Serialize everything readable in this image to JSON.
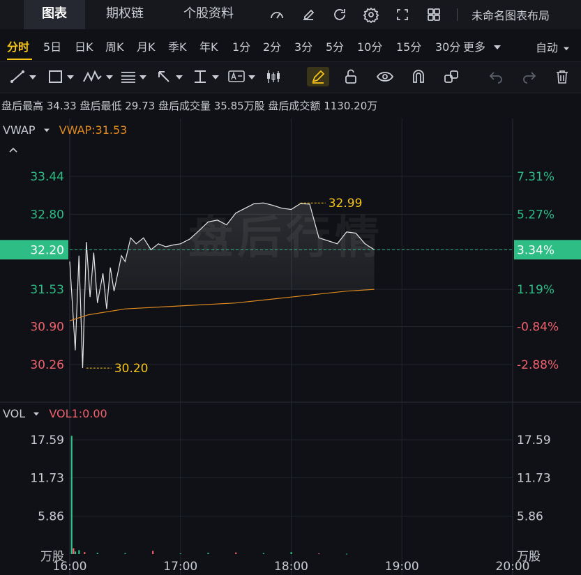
{
  "tabs": [
    {
      "label": "图表",
      "active": true
    },
    {
      "label": "期权链",
      "active": false
    },
    {
      "label": "个股资料",
      "active": false
    }
  ],
  "top_icons": [
    "gauge-icon",
    "edit-icon",
    "refresh-icon",
    "gear-icon",
    "fullscreen-icon",
    "grid-layout-icon"
  ],
  "layout_label": "未命名图表布局",
  "periods": [
    {
      "label": "分时",
      "active": true
    },
    {
      "label": "5日"
    },
    {
      "label": "日K"
    },
    {
      "label": "周K"
    },
    {
      "label": "月K"
    },
    {
      "label": "季K"
    },
    {
      "label": "年K"
    },
    {
      "label": "1分"
    },
    {
      "label": "2分"
    },
    {
      "label": "3分"
    },
    {
      "label": "5分"
    },
    {
      "label": "10分"
    },
    {
      "label": "15分"
    },
    {
      "label": "30分"
    },
    {
      "label": "更多"
    }
  ],
  "auto_label": "自动",
  "stats": "盘后最高 34.33 盘后最低 29.73 盘后成交量 35.85万股 盘后成交额 1130.20万",
  "watermark": "盘后行情",
  "main_legend": {
    "indicator": "VWAP",
    "value_label": "VWAP:31.53"
  },
  "vol_legend": {
    "indicator": "VOL",
    "value_label": "VOL1:0.00"
  },
  "price_ticks": [
    "33.44",
    "32.80",
    "32.20",
    "31.53",
    "30.90",
    "30.26"
  ],
  "pct_ticks": [
    "7.31%",
    "5.27%",
    "3.34%",
    "1.19%",
    "-0.84%",
    "-2.88%"
  ],
  "current_price": "32.20",
  "current_pct": "3.34%",
  "high_label": "32.99",
  "low_label": "30.20",
  "vol_ticks": [
    "17.59",
    "11.73",
    "5.86"
  ],
  "vol_unit": "万股",
  "time_ticks": [
    "16:00",
    "17:00",
    "18:00",
    "19:00",
    "20:00"
  ],
  "colors": {
    "up": "#2ebd85",
    "down": "#f0616d",
    "accent": "#f5c518",
    "vwap": "#e08a1e",
    "price_line": "#e6e6e6",
    "bg": "#0f1116"
  },
  "chart_data": {
    "type": "line",
    "x_unit": "time",
    "price_series": {
      "name": "",
      "x": [
        "16:00",
        "16:03",
        "16:05",
        "16:07",
        "16:09",
        "16:11",
        "16:13",
        "16:15",
        "16:18",
        "16:20",
        "16:22",
        "16:24",
        "16:26",
        "16:28",
        "16:30",
        "16:33",
        "16:36",
        "16:40",
        "16:44",
        "16:48",
        "16:52",
        "16:56",
        "17:00",
        "17:05",
        "17:10",
        "17:15",
        "17:20",
        "17:25",
        "17:30",
        "17:35",
        "17:40",
        "17:45",
        "17:50",
        "17:55",
        "18:00",
        "18:05",
        "18:10",
        "18:15",
        "18:20",
        "18:25",
        "18:30",
        "18:35",
        "18:40",
        "18:45"
      ],
      "values": [
        32.0,
        30.5,
        32.1,
        30.2,
        32.33,
        31.4,
        32.15,
        31.3,
        31.8,
        31.2,
        31.9,
        31.5,
        31.8,
        32.1,
        32.0,
        32.4,
        32.3,
        32.4,
        32.2,
        32.3,
        32.25,
        32.28,
        32.3,
        32.38,
        32.52,
        32.67,
        32.7,
        32.62,
        32.82,
        32.9,
        32.98,
        32.99,
        32.95,
        32.9,
        32.88,
        32.98,
        32.97,
        32.4,
        32.35,
        32.3,
        32.5,
        32.48,
        32.3,
        32.2
      ]
    },
    "vwap_series": {
      "x": [
        "16:00",
        "16:10",
        "16:30",
        "17:00",
        "17:30",
        "18:00",
        "18:30",
        "18:45"
      ],
      "values": [
        31.0,
        31.1,
        31.2,
        31.25,
        31.3,
        31.4,
        31.5,
        31.53
      ]
    },
    "volume_series": {
      "x": [
        "16:01",
        "16:02",
        "16:03",
        "16:05",
        "16:08",
        "16:15",
        "16:30",
        "16:45",
        "17:00",
        "17:15",
        "17:30",
        "17:45",
        "18:00",
        "18:15",
        "18:30"
      ],
      "values": [
        18.2,
        0.9,
        0.4,
        0.6,
        0.3,
        0.2,
        0.15,
        0.5,
        0.1,
        0.2,
        0.25,
        0.15,
        0.3,
        0.1,
        0.05
      ]
    },
    "price_range": [
      29.73,
      34.33
    ],
    "volume_range": [
      0,
      20.5
    ],
    "time_range": [
      "16:00",
      "20:00"
    ],
    "grid": true
  }
}
